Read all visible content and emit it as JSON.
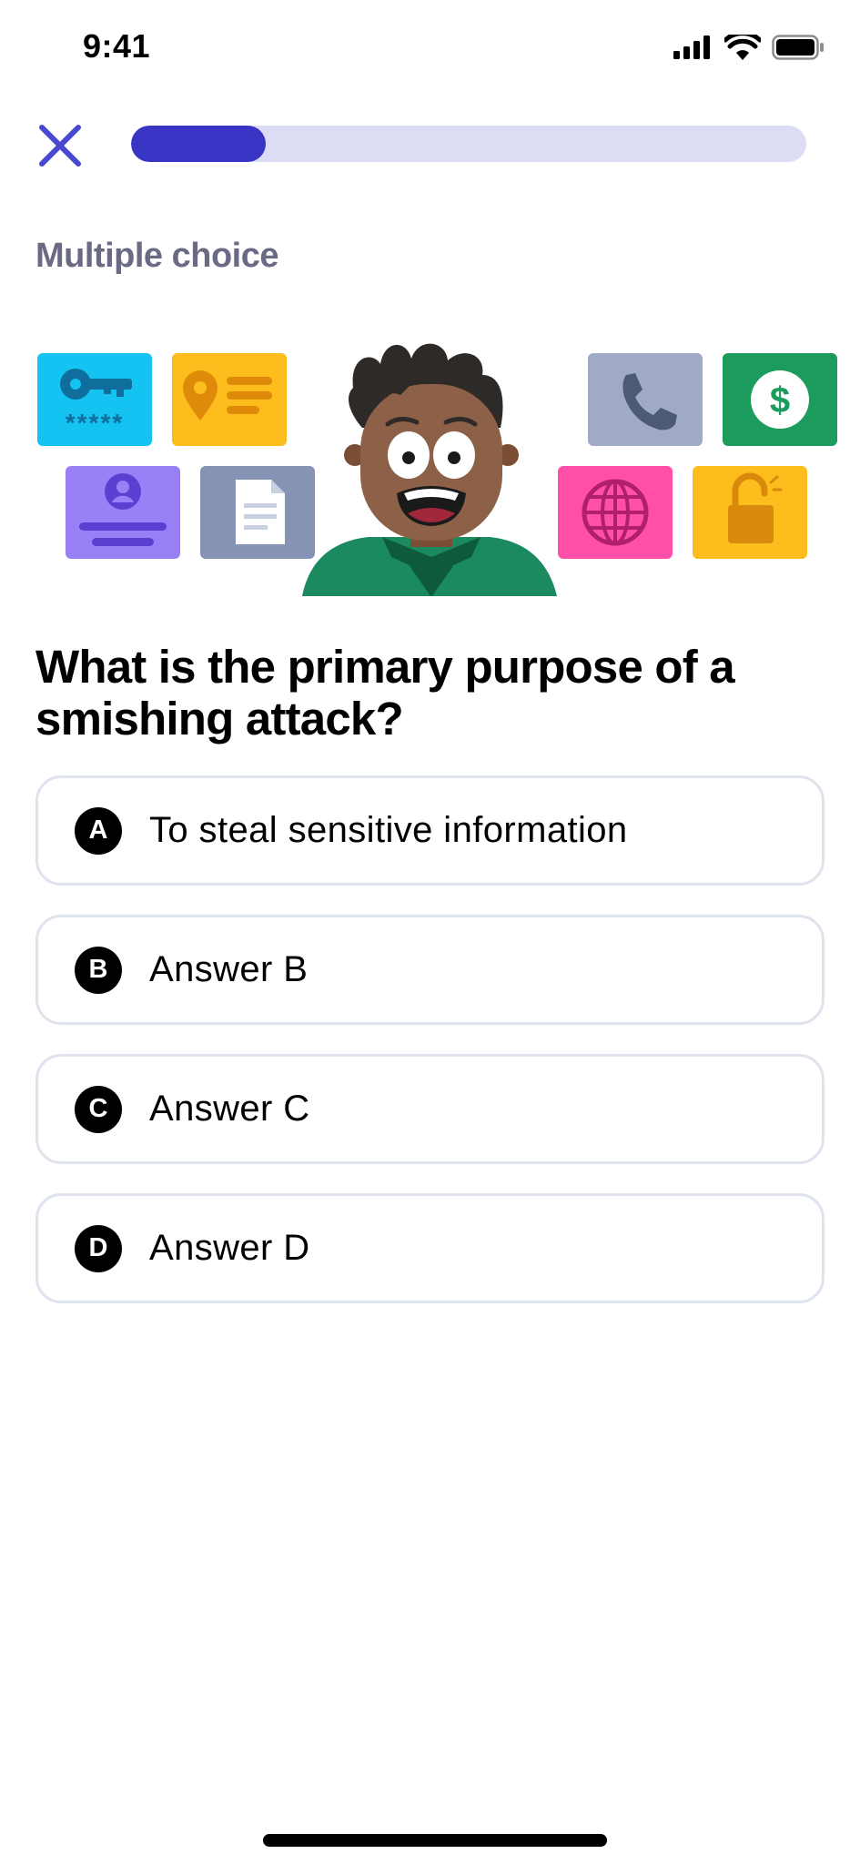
{
  "status_bar": {
    "time": "9:41"
  },
  "header": {
    "progress": 0.2
  },
  "section_label": "Multiple choice",
  "illustration": {
    "tiles": [
      "key-icon",
      "location-pin-icon",
      "id-card-icon",
      "document-icon",
      "phone-icon",
      "dollar-icon",
      "globe-icon",
      "unlocked-padlock-icon"
    ],
    "password_mask": "*****",
    "dollar_sign": "$"
  },
  "question": "What is the primary purpose of a smishing attack?",
  "answers": [
    {
      "letter": "A",
      "text": "To steal sensitive information"
    },
    {
      "letter": "B",
      "text": "Answer B"
    },
    {
      "letter": "C",
      "text": "Answer C"
    },
    {
      "letter": "D",
      "text": "Answer D"
    }
  ],
  "colors": {
    "accent": "#3835c4",
    "progress_track": "#dcdcf5",
    "close_icon": "#4a47d1",
    "section_label": "#6a6a84",
    "answer_border": "#dfe3ed"
  }
}
